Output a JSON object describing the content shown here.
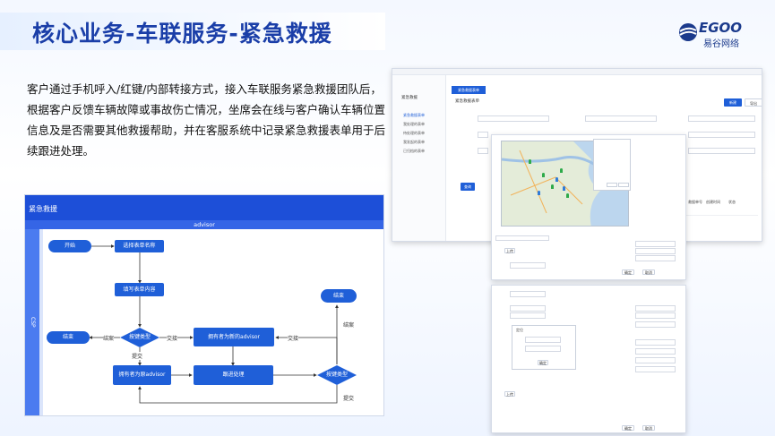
{
  "title": "核心业务-车联服务-紧急救援",
  "logo": {
    "en": "EGOO",
    "cn": "易谷网络"
  },
  "description": "客户通过手机呼入/红键/内部转接方式，接入车联服务紧急救援团队后，根据客户反馈车辆故障或事故伤亡情况，坐席会在线与客户确认车辆位置信息及是否需要其他救援帮助，并在客服系统中记录紧急救援表单用于后续跟进处理。",
  "flowchart": {
    "header": "紧急救援",
    "lane_top": "advisor",
    "lane_side": "CSP",
    "nodes": {
      "start": "开始",
      "choose_form": "选择表单名称",
      "fill_form": "填写表单内容",
      "end_left": "结束",
      "end_right": "结束",
      "decision_1": "按键类型",
      "decision_2": "按键类型",
      "new_advisor": "拥有者为新的advisor",
      "orig_advisor": "拥有者为原advisor",
      "follow_up": "跟进处理"
    },
    "edges": {
      "finish_left": "结案",
      "transfer_mid": "交接",
      "submit_mid": "提交",
      "transfer_right": "交接",
      "finish_right": "结案",
      "submit_bottom": "提交"
    }
  },
  "screenshot_main": {
    "tab": "紧急救援表单",
    "form_title": "紧急救援表单",
    "buttons": [
      "新建",
      "导出"
    ],
    "query_button": "查询",
    "sidebar_title": "紧急救援",
    "sidebar_items": [
      "紧急救援表单",
      "我处理的表单",
      "待处理的表单",
      "我发起的表单",
      "已归档的表单"
    ],
    "table_headers": [
      "救援单号",
      "创建时间",
      "状态"
    ]
  },
  "screenshot_form_a": {
    "button_confirm": "确定",
    "button_cancel": "取消",
    "add_button": "上传"
  },
  "screenshot_form_b": {
    "button_confirm": "确定",
    "button_cancel": "取消",
    "popup_title": "定位",
    "popup_button": "确定",
    "add_button": "上传"
  },
  "colors": {
    "title": "#1a3ea8",
    "flow_header": "#1d4fd8",
    "node": "#1f5fd8"
  }
}
